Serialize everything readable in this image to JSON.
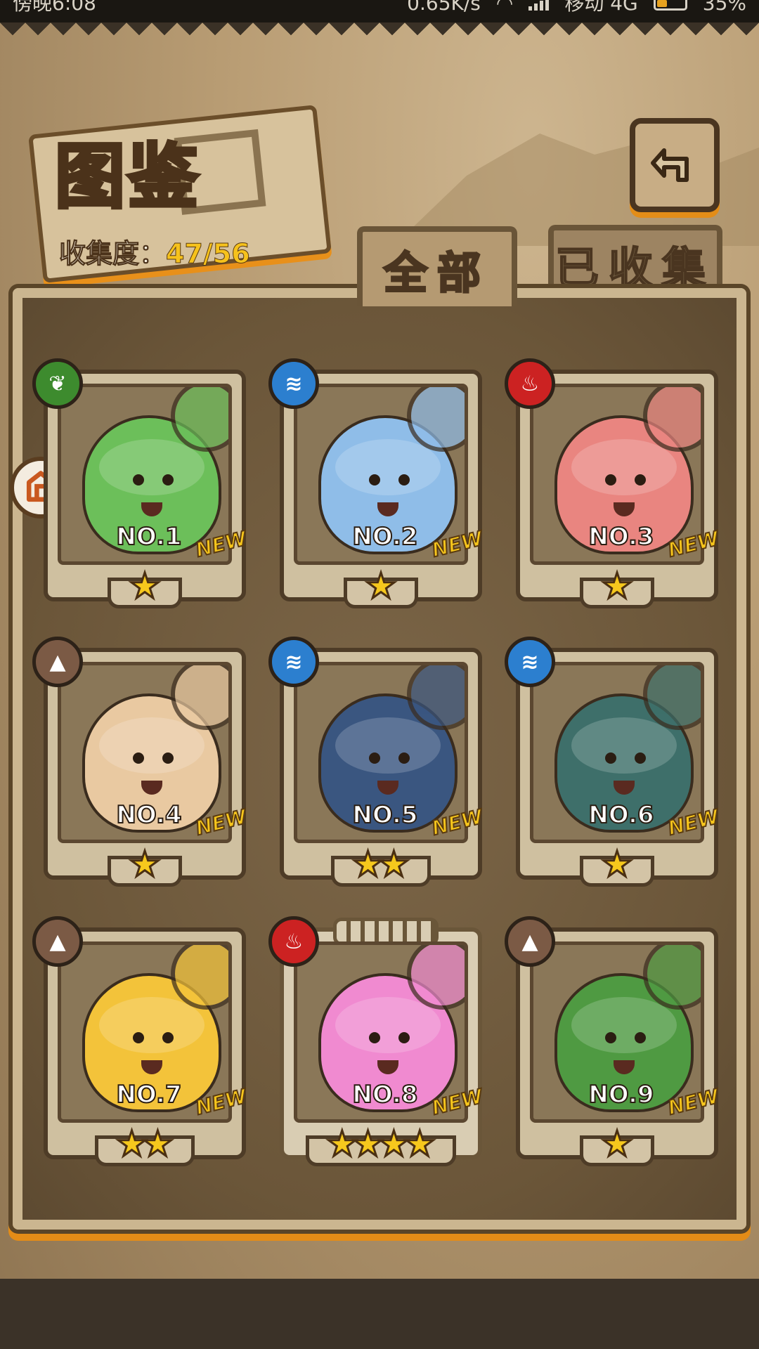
{
  "status_bar": {
    "time": "傍晚6:08",
    "speed": "0.65K/s",
    "carrier": "移动 4G",
    "battery": "35%"
  },
  "header": {
    "title": "图鉴",
    "collect_label": "收集度：",
    "collect_value": "47/56"
  },
  "tabs": [
    {
      "label": "全部",
      "active": true
    },
    {
      "label": "已收集",
      "active": false
    }
  ],
  "cards": [
    {
      "number": "NO.1",
      "element": "grass-icon",
      "stars": "★",
      "new": "NEW",
      "color": "#6cbf5a"
    },
    {
      "number": "NO.2",
      "element": "water-icon",
      "stars": "★",
      "new": "NEW",
      "color": "#8fbde8"
    },
    {
      "number": "NO.3",
      "element": "fire-icon",
      "stars": "★",
      "new": "NEW",
      "color": "#e98580"
    },
    {
      "number": "NO.4",
      "element": "earth-icon",
      "stars": "★",
      "new": "NEW",
      "color": "#e9c9a1"
    },
    {
      "number": "NO.5",
      "element": "water-icon",
      "stars": "★★",
      "new": "NEW",
      "color": "#3a5680"
    },
    {
      "number": "NO.6",
      "element": "water-icon",
      "stars": "★",
      "new": "NEW",
      "color": "#3e6f6a"
    },
    {
      "number": "NO.7",
      "element": "earth-icon",
      "stars": "★★",
      "new": "NEW",
      "color": "#f3c33a"
    },
    {
      "number": "NO.8",
      "element": "fire-icon",
      "stars": "★★★★",
      "new": "NEW",
      "color": "#f08ad0"
    },
    {
      "number": "NO.9",
      "element": "earth-icon",
      "stars": "★",
      "new": "NEW",
      "color": "#4f9a42"
    }
  ],
  "colors": {
    "accent": "#f6c21c",
    "grass": "#3d8b2e",
    "water": "#2c7fcf",
    "fire": "#cc2222",
    "earth": "#7b5a45"
  }
}
